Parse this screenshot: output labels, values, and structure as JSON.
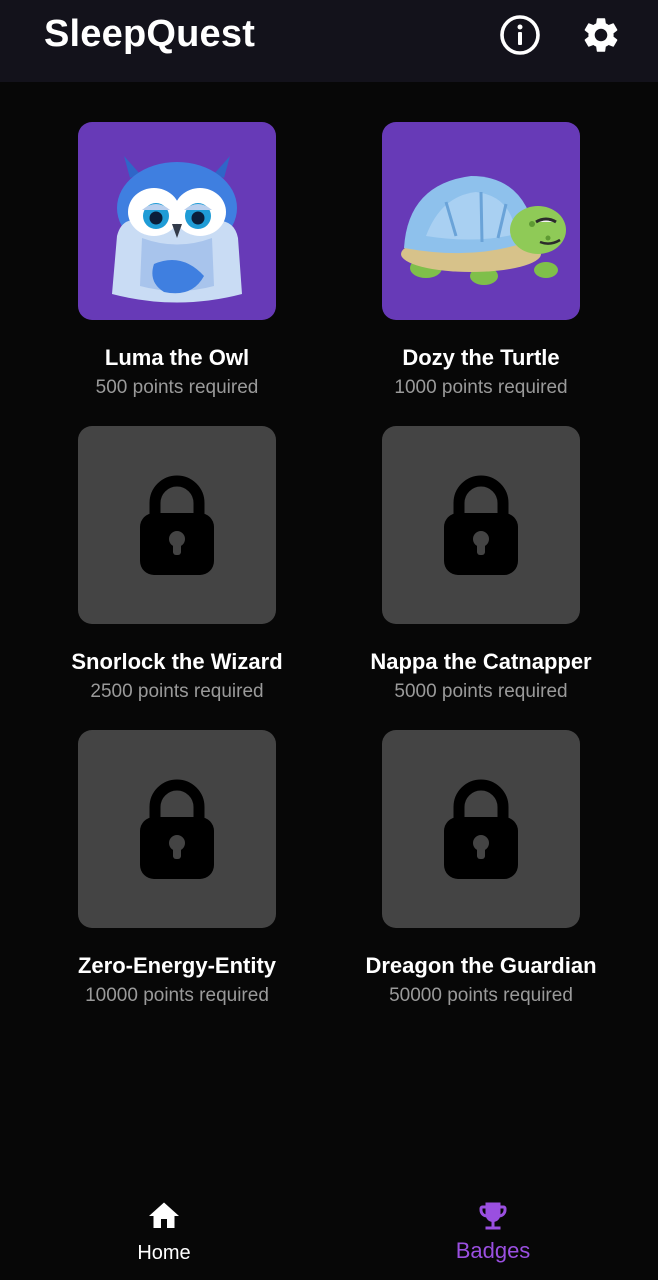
{
  "app": {
    "title": "SleepQuest"
  },
  "header": {
    "info_icon": "info-circle-icon",
    "settings_icon": "gear-icon"
  },
  "badges": [
    {
      "name": "Luma the Owl",
      "points": "500 points required",
      "unlocked": true,
      "image": "owl-illustration"
    },
    {
      "name": "Dozy the Turtle",
      "points": "1000 points required",
      "unlocked": true,
      "image": "turtle-illustration"
    },
    {
      "name": "Snorlock the Wizard",
      "points": "2500 points required",
      "unlocked": false,
      "image": "lock-icon"
    },
    {
      "name": "Nappa the Catnapper",
      "points": "5000 points required",
      "unlocked": false,
      "image": "lock-icon"
    },
    {
      "name": "Zero-Energy-Entity",
      "points": "10000 points required",
      "unlocked": false,
      "image": "lock-icon"
    },
    {
      "name": "Dreagon the Guardian",
      "points": "50000 points required",
      "unlocked": false,
      "image": "lock-icon"
    }
  ],
  "nav": {
    "items": [
      {
        "label": "Home",
        "icon": "home-icon",
        "active": false
      },
      {
        "label": "Badges",
        "icon": "trophy-icon",
        "active": true
      }
    ]
  },
  "colors": {
    "background": "#070707",
    "appbar": "#13121b",
    "unlocked_tile": "#673ab7",
    "locked_tile": "#444444",
    "secondary_text": "#9a9a9a",
    "accent": "#9a4fe0"
  }
}
